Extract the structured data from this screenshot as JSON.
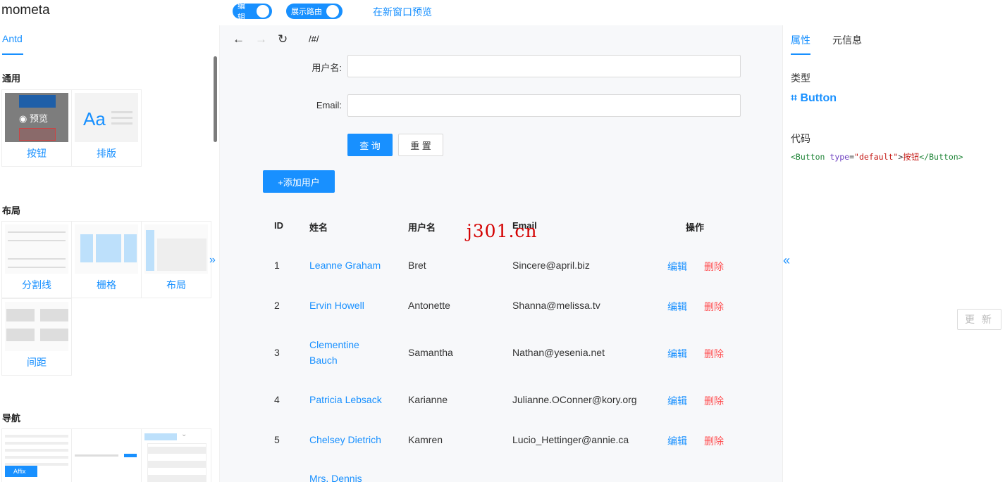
{
  "app": {
    "title": "mometa"
  },
  "topbar": {
    "edit_toggle_label": "编辑",
    "route_toggle_label": "展示路由",
    "preview_link": "在新窗口预览"
  },
  "left": {
    "tab": "Antd",
    "sections": [
      {
        "title": "通用",
        "items": [
          "按钮",
          "排版"
        ]
      },
      {
        "title": "布局",
        "items": [
          "分割线",
          "栅格",
          "布局",
          "间距"
        ]
      },
      {
        "title": "导航",
        "items": []
      }
    ],
    "hover_preview_label": "预览",
    "typography_thumb_text": "Aa",
    "affix_thumb_text": "Affix",
    "collapse_icon": "»"
  },
  "middle": {
    "path": "/#/",
    "form": {
      "username_label": "用户名",
      "email_label": "Email",
      "username_value": "",
      "email_value": "",
      "search_button": "查 询",
      "reset_button": "重 置"
    },
    "add_user_button": "+添加用户",
    "table": {
      "headers": [
        "ID",
        "姓名",
        "用户名",
        "Email",
        "操作"
      ],
      "rows": [
        {
          "id": "1",
          "name_line1": "Leanne Graham",
          "name_line2": "",
          "username": "Bret",
          "email": "Sincere@april.biz"
        },
        {
          "id": "2",
          "name_line1": "Ervin Howell",
          "name_line2": "",
          "username": "Antonette",
          "email": "Shanna@melissa.tv"
        },
        {
          "id": "3",
          "name_line1": "Clementine",
          "name_line2": "Bauch",
          "username": "Samantha",
          "email": "Nathan@yesenia.net"
        },
        {
          "id": "4",
          "name_line1": "Patricia Lebsack",
          "name_line2": "",
          "username": "Karianne",
          "email": "Julianne.OConner@kory.org"
        },
        {
          "id": "5",
          "name_line1": "Chelsey Dietrich",
          "name_line2": "",
          "username": "Kamren",
          "email": "Lucio_Hettinger@annie.ca"
        },
        {
          "id": "",
          "name_line1": "Mrs. Dennis",
          "name_line2": "",
          "username": "",
          "email": ""
        }
      ],
      "edit_label": "编辑",
      "delete_label": "删除"
    },
    "watermark": "j301.cn"
  },
  "right": {
    "tab_props": "属性",
    "tab_meta": "元信息",
    "type_label": "类型",
    "type_value": "⌗ Button",
    "code_label": "代码",
    "code": {
      "open_tag": "<Button",
      "attr": " type",
      "eq": "=",
      "str": "\"default\"",
      "gt": ">",
      "text": "按钮",
      "close_tag": "</Button>"
    },
    "collapse_icon": "«",
    "update_button": "更 新"
  },
  "colors": {
    "accent": "#1890ff",
    "danger": "#ff4d4f",
    "watermark": "#d40000"
  }
}
